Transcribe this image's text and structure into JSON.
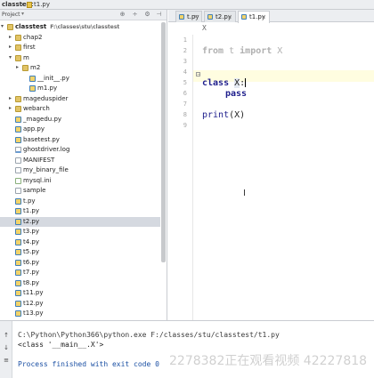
{
  "breadcrumb": {
    "project": "classtest",
    "separator": "›",
    "file": "t1.py"
  },
  "project_panel": {
    "title": "Project",
    "title_arrow": "▾",
    "header_icons": [
      "globe-icon",
      "divide-icon",
      "gear-icon",
      "collapse-icon"
    ],
    "root": {
      "label": "classtest",
      "path": "F:\\classes\\stu\\classtest"
    },
    "items": [
      {
        "label": "chap2",
        "type": "folder",
        "indent": 1,
        "expanded": false
      },
      {
        "label": "first",
        "type": "folder",
        "indent": 1,
        "expanded": false
      },
      {
        "label": "m",
        "type": "folder",
        "indent": 1,
        "expanded": true
      },
      {
        "label": "m2",
        "type": "folder",
        "indent": 2,
        "expanded": false
      },
      {
        "label": "__init__.py",
        "type": "py",
        "indent": 3
      },
      {
        "label": "m1.py",
        "type": "py",
        "indent": 3
      },
      {
        "label": "mageduspider",
        "type": "folder",
        "indent": 1
      },
      {
        "label": "webarch",
        "type": "folder",
        "indent": 1
      },
      {
        "label": "_magedu.py",
        "type": "py",
        "indent": 1
      },
      {
        "label": "app.py",
        "type": "py",
        "indent": 1
      },
      {
        "label": "basetest.py",
        "type": "py",
        "indent": 1
      },
      {
        "label": "ghostdriver.log",
        "type": "log",
        "indent": 1
      },
      {
        "label": "MANIFEST",
        "type": "txt",
        "indent": 1
      },
      {
        "label": "my_binary_file",
        "type": "txt",
        "indent": 1
      },
      {
        "label": "mysql.ini",
        "type": "ini",
        "indent": 1
      },
      {
        "label": "sample",
        "type": "txt",
        "indent": 1
      },
      {
        "label": "t.py",
        "type": "py",
        "indent": 1
      },
      {
        "label": "t1.py",
        "type": "py",
        "indent": 1
      },
      {
        "label": "t2.py",
        "type": "py",
        "indent": 1,
        "selected": true
      },
      {
        "label": "t3.py",
        "type": "py",
        "indent": 1
      },
      {
        "label": "t4.py",
        "type": "py",
        "indent": 1
      },
      {
        "label": "t5.py",
        "type": "py",
        "indent": 1
      },
      {
        "label": "t6.py",
        "type": "py",
        "indent": 1
      },
      {
        "label": "t7.py",
        "type": "py",
        "indent": 1
      },
      {
        "label": "t8.py",
        "type": "py",
        "indent": 1
      },
      {
        "label": "t11.py",
        "type": "py",
        "indent": 1
      },
      {
        "label": "t12.py",
        "type": "py",
        "indent": 1
      },
      {
        "label": "t13.py",
        "type": "py",
        "indent": 1
      }
    ]
  },
  "editor": {
    "tabs": [
      {
        "label": "t.py",
        "active": false
      },
      {
        "label": "t2.py",
        "active": false
      },
      {
        "label": "t1.py",
        "active": true
      }
    ],
    "tab_close": "×",
    "code_breadcrumb": "X",
    "line_numbers": [
      "1",
      "2",
      "3",
      "4",
      "5",
      "6",
      "7",
      "8",
      "9"
    ],
    "lines": {
      "l2_kw1": "from",
      "l2_mod": " t ",
      "l2_kw2": "import",
      "l2_name": " X",
      "l4_kw": "class",
      "l4_name_a": " ",
      "l4_name_b": "X",
      "l4_colon": ":",
      "l5_kw": "pass",
      "l7_fn": "print",
      "l7_args": "(X)"
    }
  },
  "run": {
    "output": [
      "C:\\Python\\Python366\\python.exe F:/classes/stu/classtest/t1.py",
      "<class '__main__.X'>",
      "",
      "Process finished with exit code 0"
    ],
    "watermark": "2278382正在观看视频   42227818"
  },
  "colors": {
    "keyword": "#1e1e8c",
    "selection": "#d5d9e0",
    "current_line": "#fffde0",
    "exit_text": "#1a4fa3"
  }
}
